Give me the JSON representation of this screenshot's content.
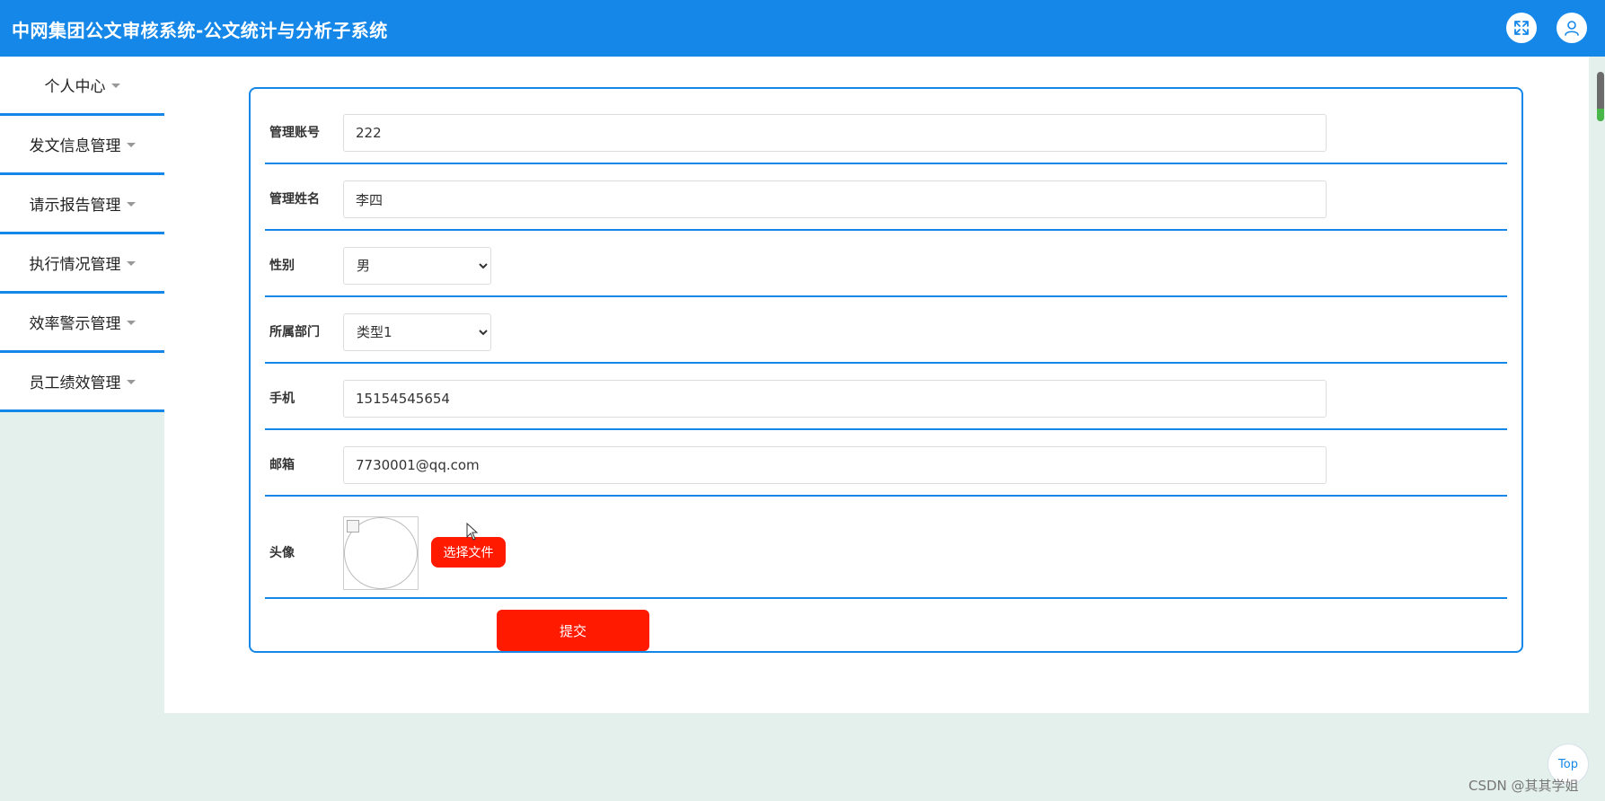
{
  "header": {
    "title": "中网集团公文审核系统-公文统计与分析子系统"
  },
  "sidebar": {
    "items": [
      {
        "label": "个人中心"
      },
      {
        "label": "发文信息管理"
      },
      {
        "label": "请示报告管理"
      },
      {
        "label": "执行情况管理"
      },
      {
        "label": "效率警示管理"
      },
      {
        "label": "员工绩效管理"
      }
    ]
  },
  "form": {
    "account": {
      "label": "管理账号",
      "value": "222"
    },
    "name": {
      "label": "管理姓名",
      "value": "李四"
    },
    "gender": {
      "label": "性别",
      "selected": "男"
    },
    "department": {
      "label": "所属部门",
      "selected": "类型1"
    },
    "phone": {
      "label": "手机",
      "value": "15154545654"
    },
    "email": {
      "label": "邮箱",
      "value": "7730001@qq.com"
    },
    "avatar": {
      "label": "头像",
      "choose_label": "选择文件"
    },
    "submit_label": "提交"
  },
  "top_button": {
    "label": "Top"
  },
  "watermark": "CSDN @其其学姐",
  "colors": {
    "header": "#1487e8",
    "accent_red": "#ff1a00",
    "page_bg": "#e4f0eb"
  }
}
